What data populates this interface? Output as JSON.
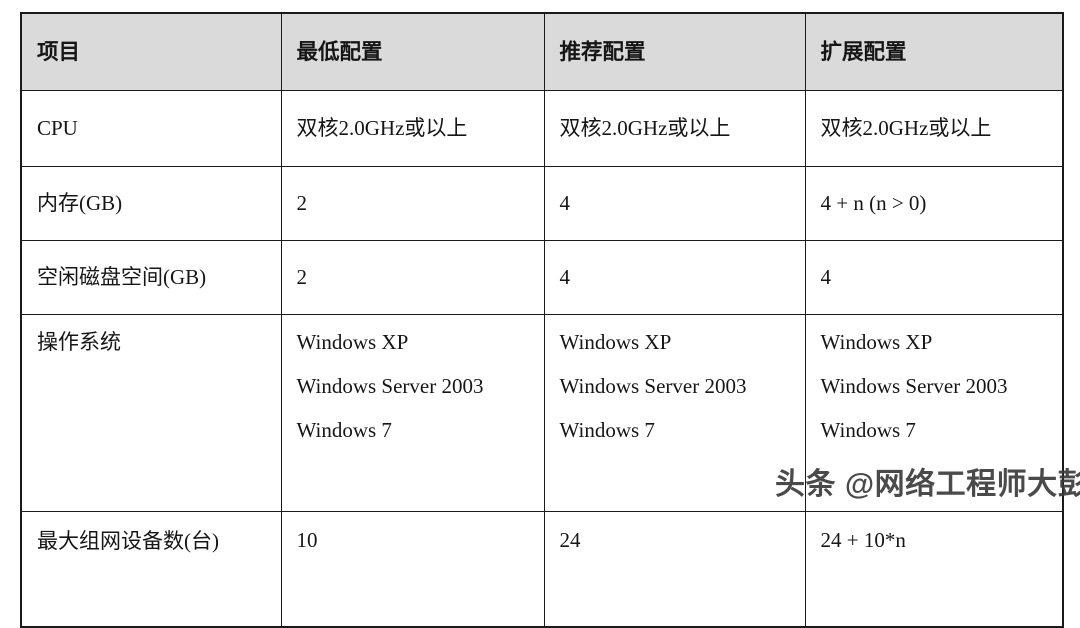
{
  "document": {
    "kind": "specification-table",
    "background_color": "#ffffff",
    "border_color": "#1a1a1a",
    "header_fill_color": "#dadada",
    "text_color": "#161616"
  },
  "table": {
    "headers": [
      "项目",
      "最低配置",
      "推荐配置",
      "扩展配置"
    ],
    "rows": [
      {
        "label": "CPU",
        "minimum": "双核2.0GHz或以上",
        "recommended": "双核2.0GHz或以上",
        "extended": "双核2.0GHz或以上"
      },
      {
        "label": "内存(GB)",
        "minimum": "2",
        "recommended": "4",
        "extended": "4 + n (n > 0)"
      },
      {
        "label": "空闲磁盘空间(GB)",
        "minimum": "2",
        "recommended": "4",
        "extended": "4"
      },
      {
        "label": "操作系统",
        "minimum_lines": [
          "Windows XP",
          "Windows Server 2003",
          "Windows 7"
        ],
        "recommended_lines": [
          "Windows XP",
          "Windows Server 2003",
          "Windows 7"
        ],
        "extended_lines": [
          "Windows XP",
          "Windows Server 2003",
          "Windows 7"
        ]
      },
      {
        "label": "最大组网设备数(台)",
        "minimum": "10",
        "recommended": "24",
        "extended": "24 + 10*n"
      }
    ]
  },
  "watermark": {
    "text": "头条 @网络工程师大彭",
    "color": "#3b3b3b"
  }
}
